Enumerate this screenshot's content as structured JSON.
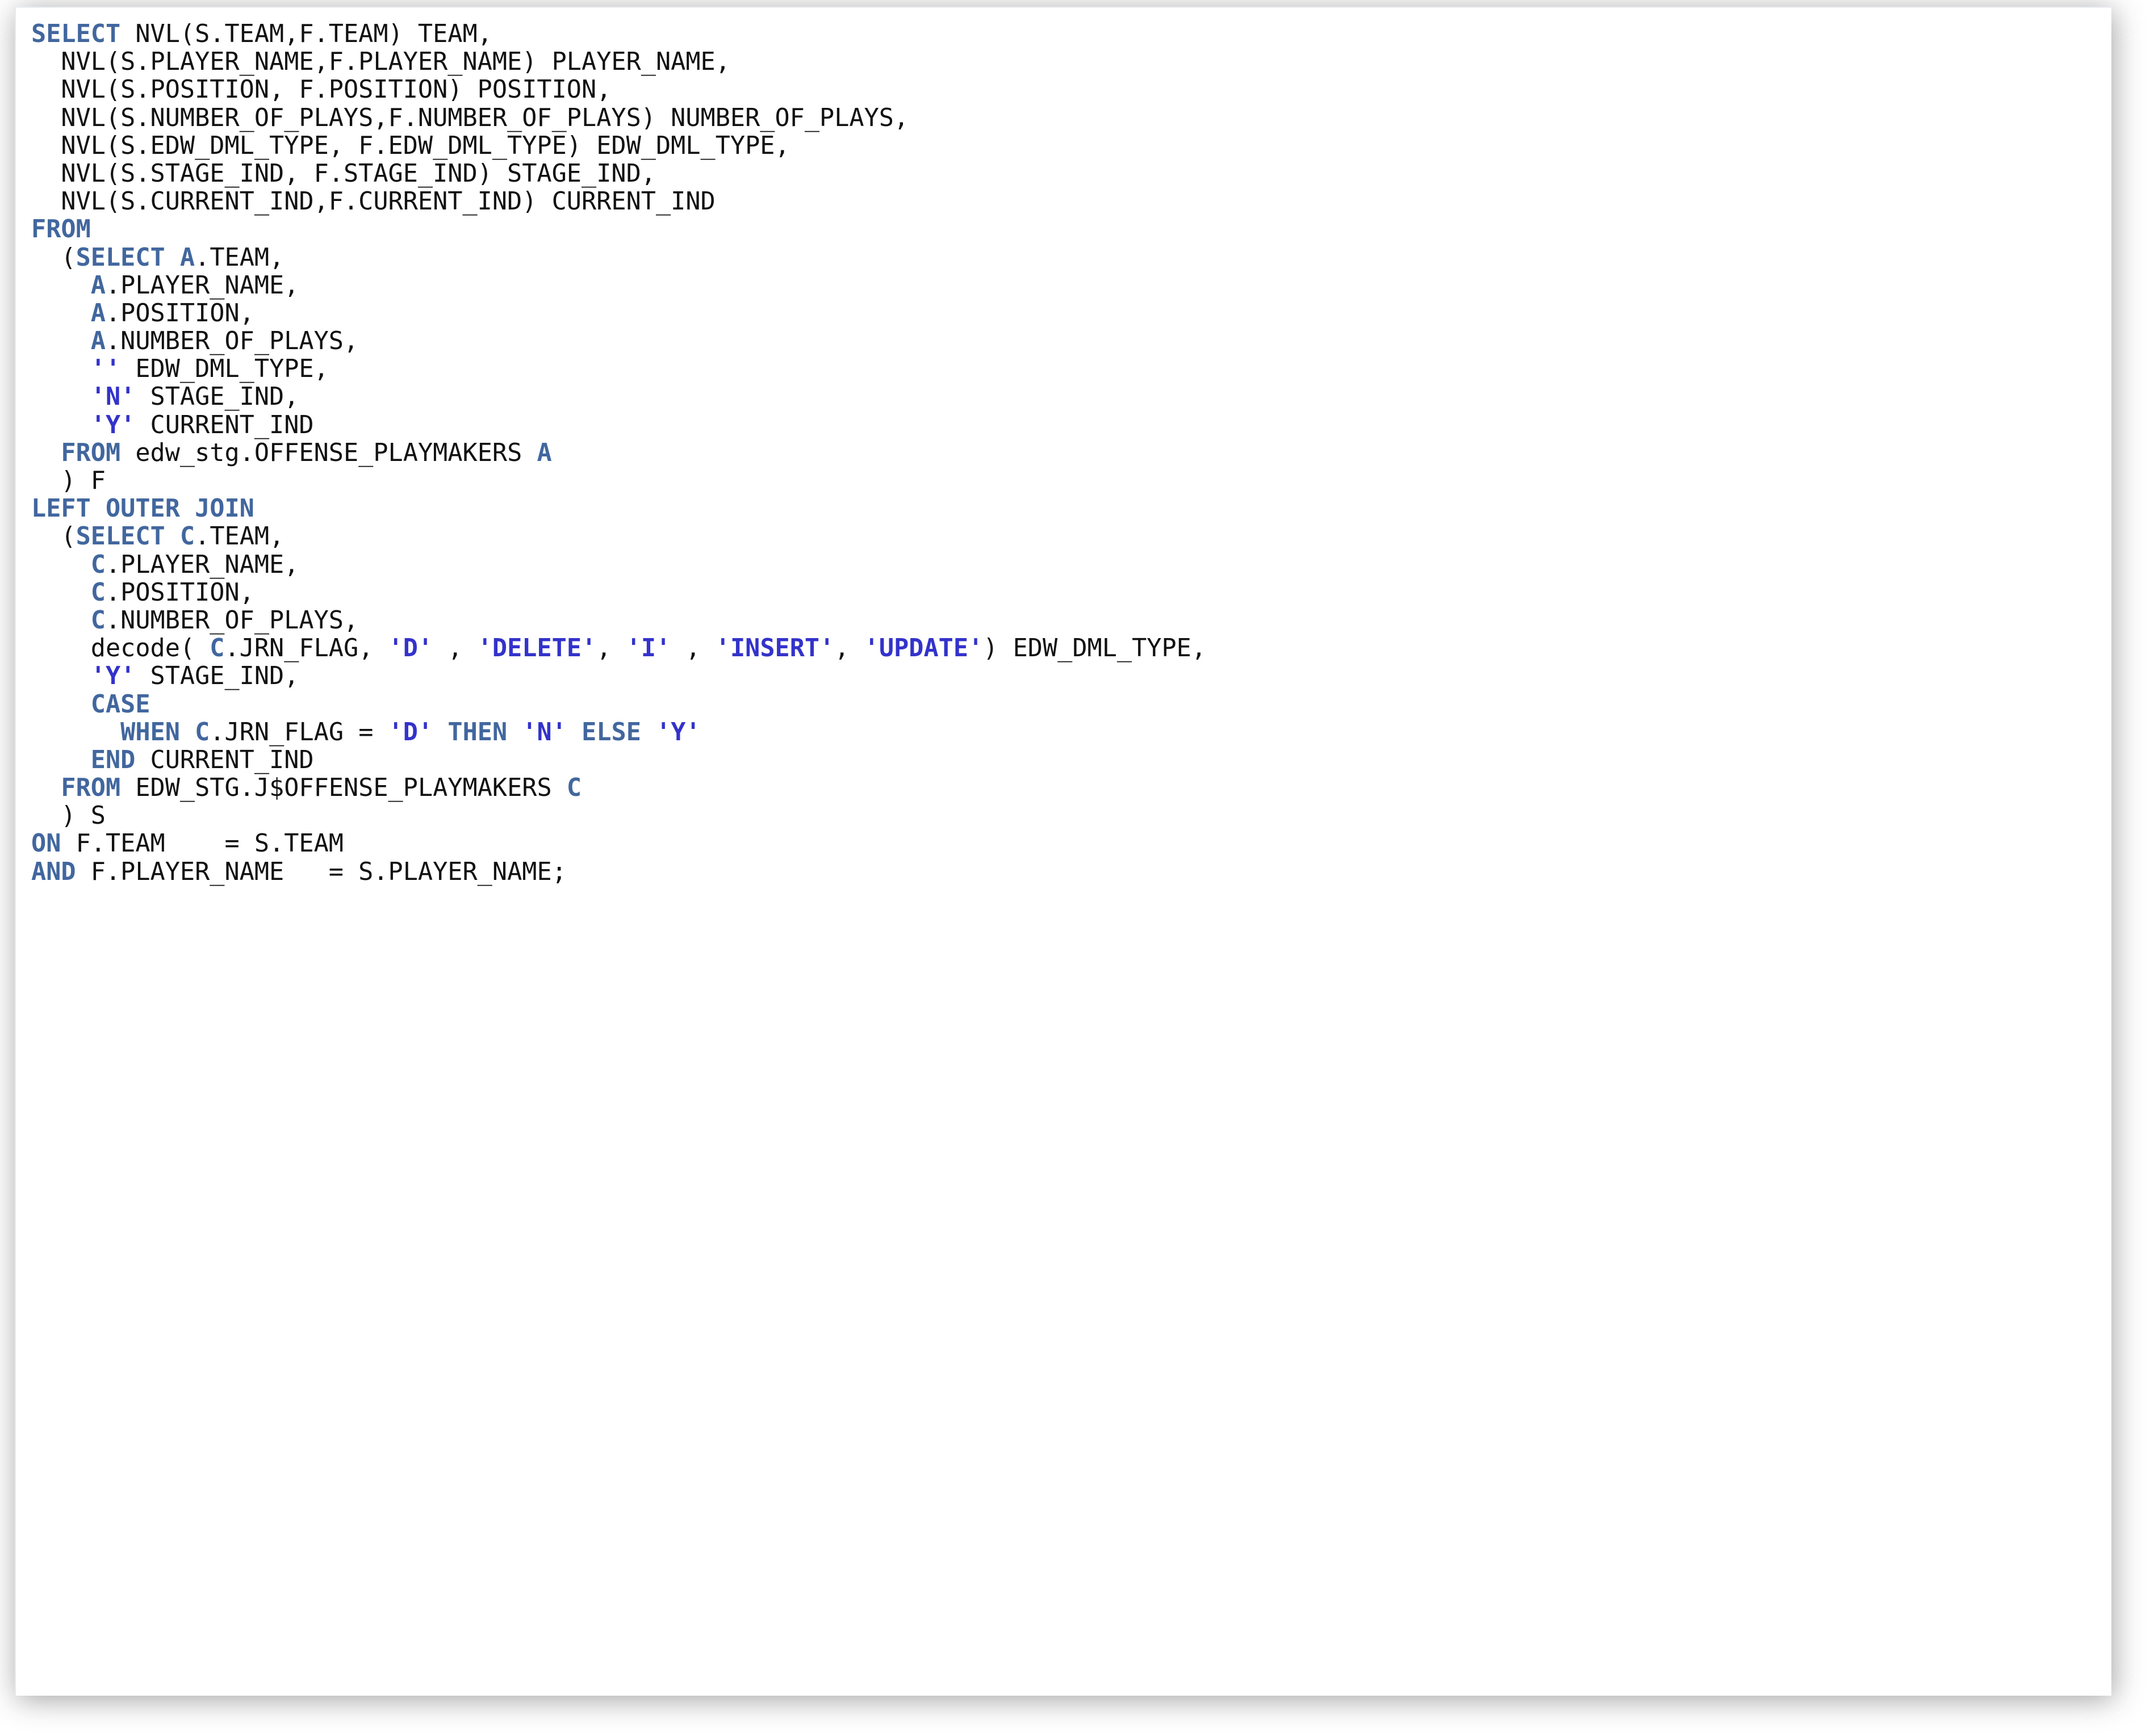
{
  "panel": {
    "background_color": "#ffffff",
    "shadow_color": "#9a9a9a"
  },
  "syntax_colors": {
    "keyword": "#42679f",
    "alias": "#42679f",
    "string_literal": "#3333cc",
    "identifier": "#111111",
    "background": "#ffffff"
  },
  "code": {
    "language": "sql",
    "full_text": "SELECT NVL(S.TEAM,F.TEAM) TEAM,\n  NVL(S.PLAYER_NAME,F.PLAYER_NAME) PLAYER_NAME,\n  NVL(S.POSITION, F.POSITION) POSITION,\n  NVL(S.NUMBER_OF_PLAYS,F.NUMBER_OF_PLAYS) NUMBER_OF_PLAYS,\n  NVL(S.EDW_DML_TYPE, F.EDW_DML_TYPE) EDW_DML_TYPE,\n  NVL(S.STAGE_IND, F.STAGE_IND) STAGE_IND,\n  NVL(S.CURRENT_IND,F.CURRENT_IND) CURRENT_IND\nFROM\n  (SELECT A.TEAM,\n    A.PLAYER_NAME,\n    A.POSITION,\n    A.NUMBER_OF_PLAYS,\n    '' EDW_DML_TYPE,\n    'N' STAGE_IND,\n    'Y' CURRENT_IND\n  FROM edw_stg.OFFENSE_PLAYMAKERS A\n  ) F\nLEFT OUTER JOIN\n  (SELECT C.TEAM,\n    C.PLAYER_NAME,\n    C.POSITION,\n    C.NUMBER_OF_PLAYS,\n    decode( C.JRN_FLAG, 'D' , 'DELETE', 'I' , 'INSERT', 'UPDATE') EDW_DML_TYPE,\n    'Y' STAGE_IND,\n    CASE\n      WHEN C.JRN_FLAG = 'D' THEN 'N' ELSE 'Y'\n    END CURRENT_IND\n  FROM EDW_STG.J$OFFENSE_PLAYMAKERS C\n  ) S\nON F.TEAM    = S.TEAM\nAND F.PLAYER_NAME   = S.PLAYER_NAME;",
    "lines": [
      {
        "n": 1,
        "text": "SELECT NVL(S.TEAM,F.TEAM) TEAM,"
      },
      {
        "n": 2,
        "text": "  NVL(S.PLAYER_NAME,F.PLAYER_NAME) PLAYER_NAME,"
      },
      {
        "n": 3,
        "text": "  NVL(S.POSITION, F.POSITION) POSITION,"
      },
      {
        "n": 4,
        "text": "  NVL(S.NUMBER_OF_PLAYS,F.NUMBER_OF_PLAYS) NUMBER_OF_PLAYS,"
      },
      {
        "n": 5,
        "text": "  NVL(S.EDW_DML_TYPE, F.EDW_DML_TYPE) EDW_DML_TYPE,"
      },
      {
        "n": 6,
        "text": "  NVL(S.STAGE_IND, F.STAGE_IND) STAGE_IND,"
      },
      {
        "n": 7,
        "text": "  NVL(S.CURRENT_IND,F.CURRENT_IND) CURRENT_IND"
      },
      {
        "n": 8,
        "text": "FROM"
      },
      {
        "n": 9,
        "text": "  (SELECT A.TEAM,"
      },
      {
        "n": 10,
        "text": "    A.PLAYER_NAME,"
      },
      {
        "n": 11,
        "text": "    A.POSITION,"
      },
      {
        "n": 12,
        "text": "    A.NUMBER_OF_PLAYS,"
      },
      {
        "n": 13,
        "text": "    '' EDW_DML_TYPE,"
      },
      {
        "n": 14,
        "text": "    'N' STAGE_IND,"
      },
      {
        "n": 15,
        "text": "    'Y' CURRENT_IND"
      },
      {
        "n": 16,
        "text": "  FROM edw_stg.OFFENSE_PLAYMAKERS A"
      },
      {
        "n": 17,
        "text": "  ) F"
      },
      {
        "n": 18,
        "text": "LEFT OUTER JOIN"
      },
      {
        "n": 19,
        "text": "  (SELECT C.TEAM,"
      },
      {
        "n": 20,
        "text": "    C.PLAYER_NAME,"
      },
      {
        "n": 21,
        "text": "    C.POSITION,"
      },
      {
        "n": 22,
        "text": "    C.NUMBER_OF_PLAYS,"
      },
      {
        "n": 23,
        "text": "    decode( C.JRN_FLAG, 'D' , 'DELETE', 'I' , 'INSERT', 'UPDATE') EDW_DML_TYPE,"
      },
      {
        "n": 24,
        "text": "    'Y' STAGE_IND,"
      },
      {
        "n": 25,
        "text": "    CASE"
      },
      {
        "n": 26,
        "text": "      WHEN C.JRN_FLAG = 'D' THEN 'N' ELSE 'Y'"
      },
      {
        "n": 27,
        "text": "    END CURRENT_IND"
      },
      {
        "n": 28,
        "text": "  FROM EDW_STG.J$OFFENSE_PLAYMAKERS C"
      },
      {
        "n": 29,
        "text": "  ) S"
      },
      {
        "n": 30,
        "text": "ON F.TEAM    = S.TEAM"
      },
      {
        "n": 31,
        "text": "AND F.PLAYER_NAME   = S.PLAYER_NAME;"
      }
    ],
    "tokens": [
      [
        {
          "t": "SELECT",
          "c": "kw"
        },
        {
          "t": " NVL(S.TEAM,F.TEAM) TEAM,",
          "c": "id"
        }
      ],
      [
        {
          "t": "  NVL(S.PLAYER_NAME,F.PLAYER_NAME) PLAYER_NAME,",
          "c": "id"
        }
      ],
      [
        {
          "t": "  NVL(S.POSITION, F.POSITION) POSITION,",
          "c": "id"
        }
      ],
      [
        {
          "t": "  NVL(S.NUMBER_OF_PLAYS,F.NUMBER_OF_PLAYS) NUMBER_OF_PLAYS,",
          "c": "id"
        }
      ],
      [
        {
          "t": "  NVL(S.EDW_DML_TYPE, F.EDW_DML_TYPE) EDW_DML_TYPE,",
          "c": "id"
        }
      ],
      [
        {
          "t": "  NVL(S.STAGE_IND, F.STAGE_IND) STAGE_IND,",
          "c": "id"
        }
      ],
      [
        {
          "t": "  NVL(S.CURRENT_IND,F.CURRENT_IND) CURRENT_IND",
          "c": "id"
        }
      ],
      [
        {
          "t": "FROM",
          "c": "kw"
        }
      ],
      [
        {
          "t": "  (",
          "c": "id"
        },
        {
          "t": "SELECT",
          "c": "kw"
        },
        {
          "t": " ",
          "c": "id"
        },
        {
          "t": "A",
          "c": "alias"
        },
        {
          "t": ".TEAM,",
          "c": "id"
        }
      ],
      [
        {
          "t": "    ",
          "c": "id"
        },
        {
          "t": "A",
          "c": "alias"
        },
        {
          "t": ".PLAYER_NAME,",
          "c": "id"
        }
      ],
      [
        {
          "t": "    ",
          "c": "id"
        },
        {
          "t": "A",
          "c": "alias"
        },
        {
          "t": ".POSITION,",
          "c": "id"
        }
      ],
      [
        {
          "t": "    ",
          "c": "id"
        },
        {
          "t": "A",
          "c": "alias"
        },
        {
          "t": ".NUMBER_OF_PLAYS,",
          "c": "id"
        }
      ],
      [
        {
          "t": "    ",
          "c": "id"
        },
        {
          "t": "''",
          "c": "str"
        },
        {
          "t": " EDW_DML_TYPE,",
          "c": "id"
        }
      ],
      [
        {
          "t": "    ",
          "c": "id"
        },
        {
          "t": "'N'",
          "c": "str"
        },
        {
          "t": " STAGE_IND,",
          "c": "id"
        }
      ],
      [
        {
          "t": "    ",
          "c": "id"
        },
        {
          "t": "'Y'",
          "c": "str"
        },
        {
          "t": " CURRENT_IND",
          "c": "id"
        }
      ],
      [
        {
          "t": "  ",
          "c": "id"
        },
        {
          "t": "FROM",
          "c": "kw"
        },
        {
          "t": " edw_stg.OFFENSE_PLAYMAKERS ",
          "c": "id"
        },
        {
          "t": "A",
          "c": "alias"
        }
      ],
      [
        {
          "t": "  ) F",
          "c": "id"
        }
      ],
      [
        {
          "t": "LEFT OUTER JOIN",
          "c": "kw"
        }
      ],
      [
        {
          "t": "  (",
          "c": "id"
        },
        {
          "t": "SELECT",
          "c": "kw"
        },
        {
          "t": " ",
          "c": "id"
        },
        {
          "t": "C",
          "c": "alias"
        },
        {
          "t": ".TEAM,",
          "c": "id"
        }
      ],
      [
        {
          "t": "    ",
          "c": "id"
        },
        {
          "t": "C",
          "c": "alias"
        },
        {
          "t": ".PLAYER_NAME,",
          "c": "id"
        }
      ],
      [
        {
          "t": "    ",
          "c": "id"
        },
        {
          "t": "C",
          "c": "alias"
        },
        {
          "t": ".POSITION,",
          "c": "id"
        }
      ],
      [
        {
          "t": "    ",
          "c": "id"
        },
        {
          "t": "C",
          "c": "alias"
        },
        {
          "t": ".NUMBER_OF_PLAYS,",
          "c": "id"
        }
      ],
      [
        {
          "t": "    decode( ",
          "c": "id"
        },
        {
          "t": "C",
          "c": "alias"
        },
        {
          "t": ".JRN_FLAG, ",
          "c": "id"
        },
        {
          "t": "'D'",
          "c": "str"
        },
        {
          "t": " , ",
          "c": "id"
        },
        {
          "t": "'DELETE'",
          "c": "str"
        },
        {
          "t": ", ",
          "c": "id"
        },
        {
          "t": "'I'",
          "c": "str"
        },
        {
          "t": " , ",
          "c": "id"
        },
        {
          "t": "'INSERT'",
          "c": "str"
        },
        {
          "t": ", ",
          "c": "id"
        },
        {
          "t": "'UPDATE'",
          "c": "str"
        },
        {
          "t": ") EDW_DML_TYPE,",
          "c": "id"
        }
      ],
      [
        {
          "t": "    ",
          "c": "id"
        },
        {
          "t": "'Y'",
          "c": "str"
        },
        {
          "t": " STAGE_IND,",
          "c": "id"
        }
      ],
      [
        {
          "t": "    ",
          "c": "id"
        },
        {
          "t": "CASE",
          "c": "kw"
        }
      ],
      [
        {
          "t": "      ",
          "c": "id"
        },
        {
          "t": "WHEN",
          "c": "kw"
        },
        {
          "t": " ",
          "c": "id"
        },
        {
          "t": "C",
          "c": "alias"
        },
        {
          "t": ".JRN_FLAG = ",
          "c": "id"
        },
        {
          "t": "'D'",
          "c": "str"
        },
        {
          "t": " ",
          "c": "id"
        },
        {
          "t": "THEN",
          "c": "kw"
        },
        {
          "t": " ",
          "c": "id"
        },
        {
          "t": "'N'",
          "c": "str"
        },
        {
          "t": " ",
          "c": "id"
        },
        {
          "t": "ELSE",
          "c": "kw"
        },
        {
          "t": " ",
          "c": "id"
        },
        {
          "t": "'Y'",
          "c": "str"
        }
      ],
      [
        {
          "t": "    ",
          "c": "id"
        },
        {
          "t": "END",
          "c": "kw"
        },
        {
          "t": " CURRENT_IND",
          "c": "id"
        }
      ],
      [
        {
          "t": "  ",
          "c": "id"
        },
        {
          "t": "FROM",
          "c": "kw"
        },
        {
          "t": " EDW_STG.J$OFFENSE_PLAYMAKERS ",
          "c": "id"
        },
        {
          "t": "C",
          "c": "alias"
        }
      ],
      [
        {
          "t": "  ) S",
          "c": "id"
        }
      ],
      [
        {
          "t": "ON",
          "c": "kw"
        },
        {
          "t": " F.TEAM    = S.TEAM",
          "c": "id"
        }
      ],
      [
        {
          "t": "AND",
          "c": "kw"
        },
        {
          "t": " F.PLAYER_NAME   = S.PLAYER_NAME;",
          "c": "id"
        }
      ]
    ]
  }
}
